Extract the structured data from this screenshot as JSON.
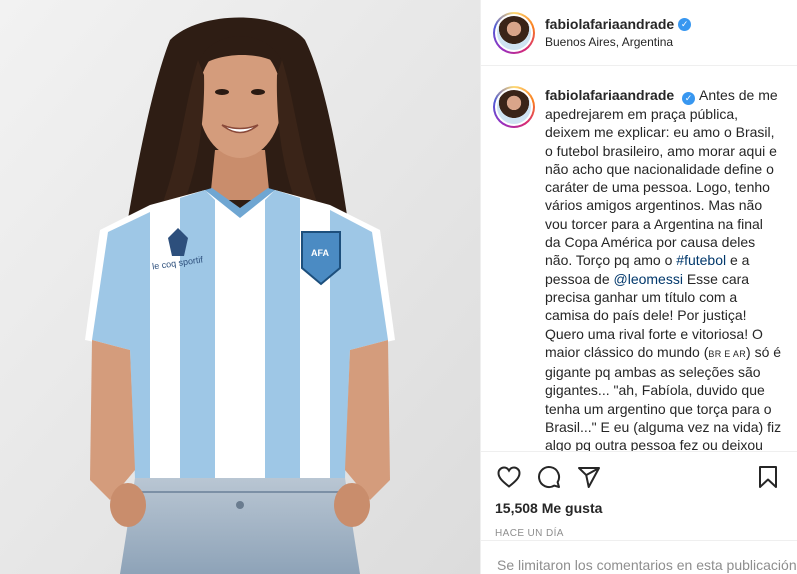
{
  "post": {
    "username": "fabiolafariaandrade",
    "verified_mark": "✓",
    "location": "Buenos Aires, Argentina",
    "caption": {
      "text_1": "Antes de me apedrejarem em praça pública, deixem me explicar: eu amo o Brasil, o futebol brasileiro, amo morar aqui e não acho que nacionalidade define o caráter de uma pessoa. Logo, tenho vários amigos argentinos. Mas não vou torcer para a Argentina na final da Copa América por causa deles não. Torço pq amo o ",
      "hashtag": "#futebol",
      "text_2": " e a pessoa de ",
      "mention": "@leomessi",
      "text_3": " Esse cara precisa ganhar um título com a camisa do país dele! Por justiça! Quero uma rival forte e vitoriosa! O maior clássico do mundo (",
      "smallcaps_1": "BR E AR",
      "text_4": ") só é gigante pq ambas as seleções são gigantes... \"ah, Fabíola, duvido que tenha um argentino que torça para o Brasil...\" E eu (alguma vez na vida) fiz algo pq outra pessoa fez ou deixou de fazer?"
    },
    "icons": {
      "like": "heart-icon",
      "comment": "comment-icon",
      "share": "paper-plane-icon",
      "save": "bookmark-icon"
    },
    "likes": "15,508 Me gusta",
    "timestamp": "HACE UN DÍA",
    "comments_disabled": "Se limitaron los comentarios en esta publicación.",
    "photo": {
      "jersey_brand": "le coq sportif",
      "crest_text": "AFA"
    }
  }
}
